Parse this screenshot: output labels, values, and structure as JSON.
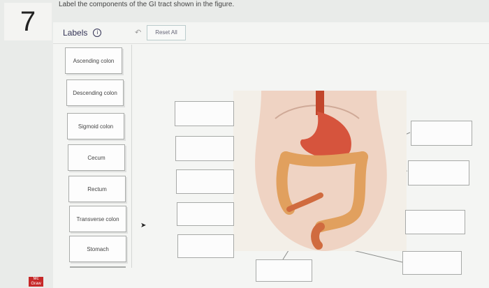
{
  "question_number": "7",
  "prompt": "Label the components of the GI tract shown in the figure.",
  "labels_heading": "Labels",
  "info_icon": "info-circle-icon",
  "undo_icon": "undo-arrow-icon",
  "reset_label": "Reset All",
  "labels": [
    "Ascending colon",
    "Descending colon",
    "Sigmoid colon",
    "Cecum",
    "Rectum",
    "Transverse colon",
    "Stomach"
  ],
  "logo": "Mc Graw"
}
